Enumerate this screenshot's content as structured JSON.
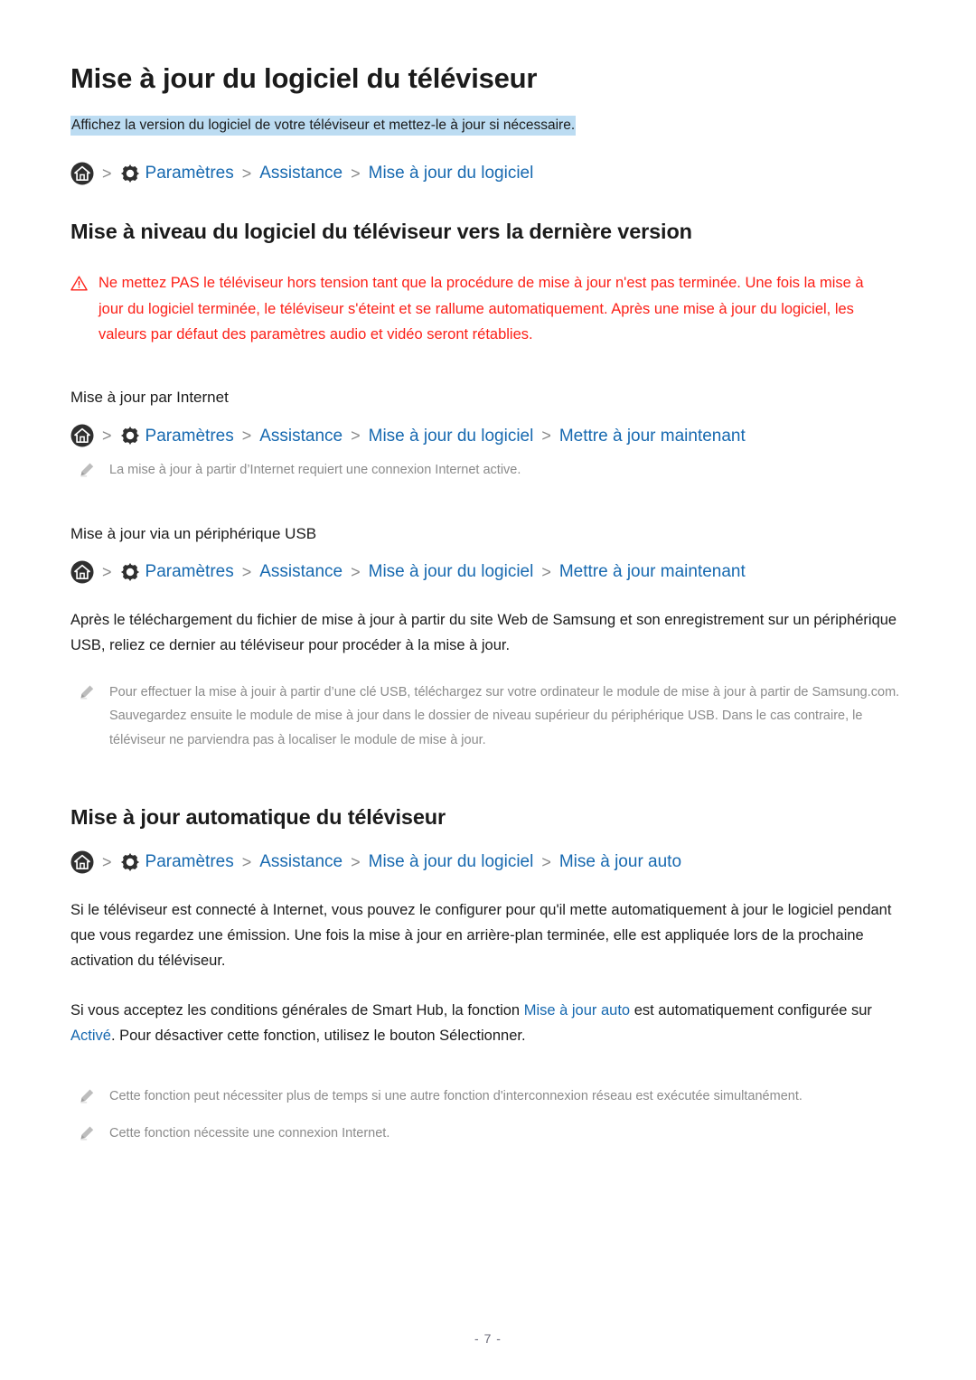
{
  "document": {
    "title": "Mise à jour du logiciel du téléviseur",
    "subtitle": "Affichez la version du logiciel de votre téléviseur et mettez-le à jour si nécessaire.",
    "page_number": "- 7 -"
  },
  "colors": {
    "link_blue": "#1769b0",
    "warning_red": "#fc2018",
    "highlight_blue": "#bcdcf2",
    "note_gray": "#8b8b8b",
    "text_black": "#1b1b1b"
  },
  "icons": {
    "home": "home-icon",
    "gear": "gear-icon",
    "warning": "warning-triangle-icon",
    "pencil": "pencil-note-icon",
    "separator": ">"
  },
  "breadcrumbs": {
    "main": [
      "Paramètres",
      "Assistance",
      "Mise à jour du logiciel"
    ],
    "internet": [
      "Paramètres",
      "Assistance",
      "Mise à jour du logiciel",
      "Mettre à jour maintenant"
    ],
    "usb": [
      "Paramètres",
      "Assistance",
      "Mise à jour du logiciel",
      "Mettre à jour maintenant"
    ],
    "auto": [
      "Paramètres",
      "Assistance",
      "Mise à jour du logiciel",
      "Mise à jour auto"
    ]
  },
  "sections": {
    "upgrade": {
      "heading": "Mise à niveau du logiciel du téléviseur vers la dernière version",
      "warning": "Ne mettez PAS le téléviseur hors tension tant que la procédure de mise à jour n'est pas terminée. Une fois la mise à jour du logiciel terminée, le téléviseur s'éteint et se rallume automatiquement. Après une mise à jour du logiciel, les valeurs par défaut des paramètres audio et vidéo seront rétablies.",
      "internet": {
        "heading": "Mise à jour par Internet",
        "note": "La mise à jour à partir d’Internet requiert une connexion Internet active."
      },
      "usb": {
        "heading": "Mise à jour via un périphérique USB",
        "paragraph": "Après le téléchargement du fichier de mise à jour à partir du site Web de Samsung et son enregistrement sur un périphérique USB, reliez ce dernier au téléviseur pour procéder à la mise à jour.",
        "note": "Pour effectuer la mise à jouir à partir d’une clé USB, téléchargez sur votre ordinateur le module de mise à jour à partir de Samsung.com. Sauvegardez ensuite le module de mise à jour dans le dossier de niveau supérieur du périphérique USB. Dans le cas contraire, le téléviseur ne parviendra pas à localiser le module de mise à jour."
      }
    },
    "auto": {
      "heading": "Mise à jour automatique du téléviseur",
      "paragraph1": "Si le téléviseur est connecté à Internet, vous pouvez le configurer pour qu'il mette automatiquement à jour le logiciel pendant que vous regardez une émission. Une fois la mise à jour en arrière-plan terminée, elle est appliquée lors de la prochaine activation du téléviseur.",
      "paragraph2": {
        "part1": "Si vous acceptez les conditions générales de Smart Hub, la fonction ",
        "link1": "Mise à jour auto",
        "part2": " est automatiquement configurée sur ",
        "link2": "Activé",
        "part3": ". Pour désactiver cette fonction, utilisez le bouton Sélectionner."
      },
      "note1": "Cette fonction peut nécessiter plus de temps si une autre fonction d'interconnexion réseau est exécutée simultanément.",
      "note2": "Cette fonction nécessite une connexion Internet."
    }
  }
}
